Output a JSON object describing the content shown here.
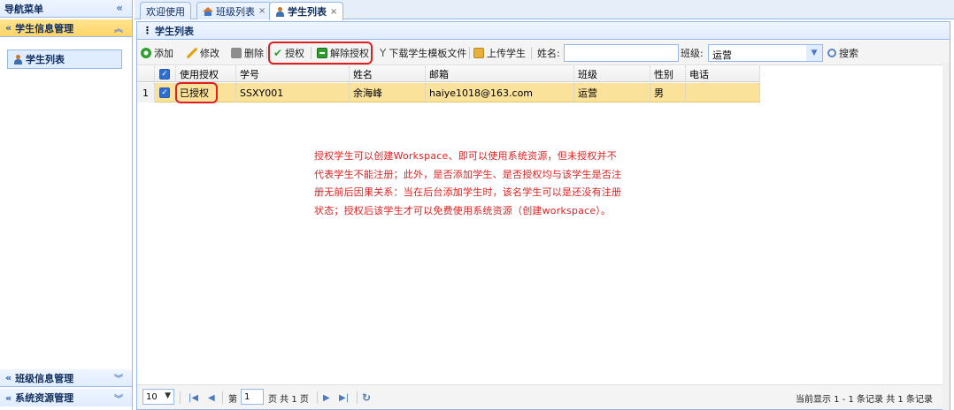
{
  "nav": {
    "title": "导航菜单",
    "collapse_icon": "double-chevron-left-icon",
    "sections": [
      {
        "label": "学生信息管理",
        "state": "expanded"
      },
      {
        "label": "班级信息管理",
        "state": "collapsed"
      },
      {
        "label": "系统资源管理",
        "state": "collapsed"
      }
    ],
    "active_item": "学生列表"
  },
  "tabs": [
    {
      "label": "欢迎使用"
    },
    {
      "label": "班级列表",
      "close": "×"
    },
    {
      "label": "学生列表",
      "close": "×"
    }
  ],
  "panel_title": "学生列表",
  "toolbar": {
    "add": "添加",
    "edit": "修改",
    "delete": "删除",
    "authorize": "授权",
    "revoke": "解除授权",
    "download_template": "下载学生模板文件",
    "upload": "上传学生",
    "name_label": "姓名:",
    "name_value": "",
    "class_label": "班级:",
    "class_value": "运营",
    "search": "搜索"
  },
  "grid": {
    "columns": [
      "使用授权",
      "学号",
      "姓名",
      "邮箱",
      "班级",
      "性别",
      "电话"
    ],
    "rows": [
      {
        "index": "1",
        "checked": true,
        "auth": "已授权",
        "student_id": "SSXY001",
        "name": "余海峰",
        "email": "haiye1018@163.com",
        "class": "运营",
        "gender": "男",
        "phone": ""
      }
    ]
  },
  "annotation": "授权学生可以创建Workspace、即可以使用系统资源，但未授权并不代表学生不能注册；此外，是否添加学生、是否授权均与该学生是否注册无前后因果关系：当在后台添加学生时，该名学生可以是还没有注册状态；授权后该学生才可以免费使用系统资源（创建workspace）。",
  "pager": {
    "page_size": "10",
    "page_prefix": "第",
    "page_value": "1",
    "page_suffix": "页 共 1 页",
    "summary": "当前显示 1 - 1 条记录 共 1 条记录"
  },
  "colors": {
    "border": "#95b8e7",
    "selected_row": "#fbe29b",
    "highlight": "#e02020"
  }
}
